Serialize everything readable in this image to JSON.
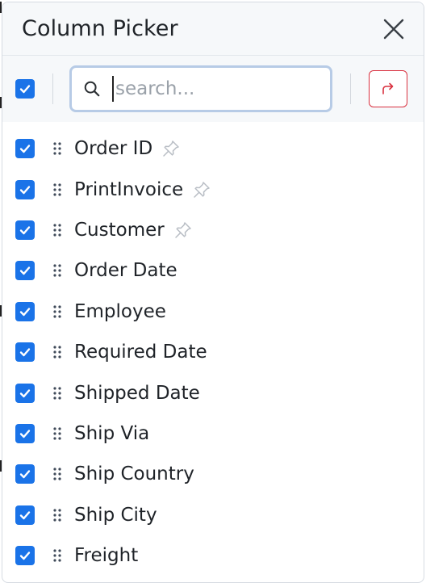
{
  "panel": {
    "title": "Column Picker"
  },
  "search": {
    "placeholder": "search..."
  },
  "colors": {
    "checkbox": "#1a73e8",
    "redo_border": "#d9313f",
    "search_border": "#b7cbe6"
  },
  "columns": [
    {
      "label": "Order ID",
      "checked": true,
      "pinned_icon": true
    },
    {
      "label": "PrintInvoice",
      "checked": true,
      "pinned_icon": true
    },
    {
      "label": "Customer",
      "checked": true,
      "pinned_icon": true
    },
    {
      "label": "Order Date",
      "checked": true,
      "pinned_icon": false
    },
    {
      "label": "Employee",
      "checked": true,
      "pinned_icon": false
    },
    {
      "label": "Required Date",
      "checked": true,
      "pinned_icon": false
    },
    {
      "label": "Shipped Date",
      "checked": true,
      "pinned_icon": false
    },
    {
      "label": "Ship Via",
      "checked": true,
      "pinned_icon": false
    },
    {
      "label": "Ship Country",
      "checked": true,
      "pinned_icon": false
    },
    {
      "label": "Ship City",
      "checked": true,
      "pinned_icon": false
    },
    {
      "label": "Freight",
      "checked": true,
      "pinned_icon": false
    }
  ]
}
